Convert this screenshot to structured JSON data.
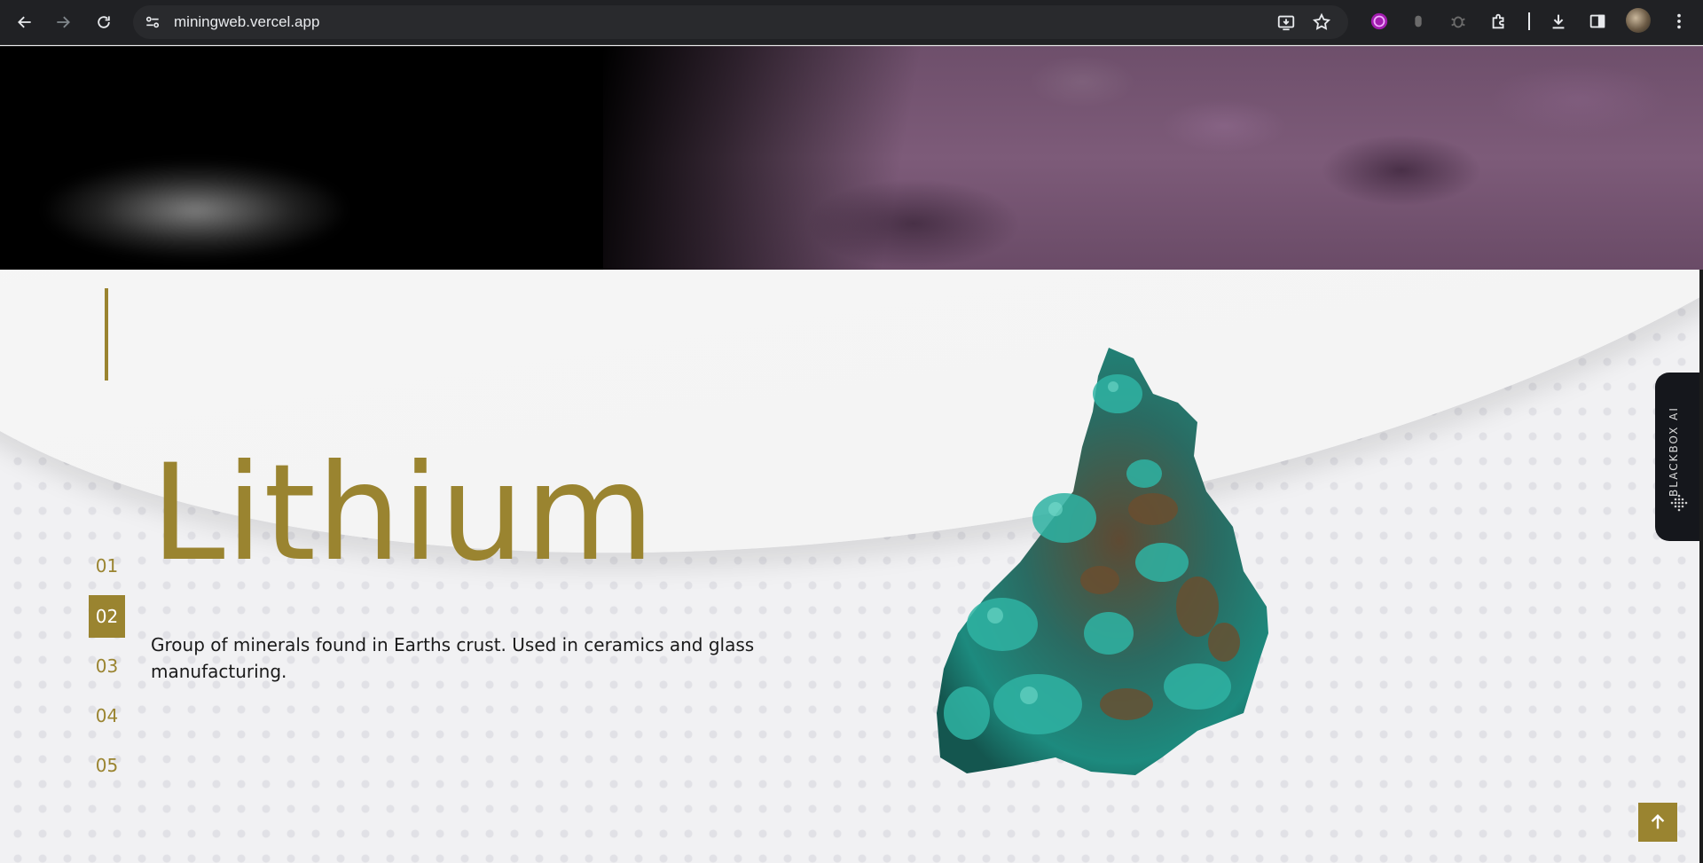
{
  "browser": {
    "url": "miningweb.vercel.app",
    "icons": [
      "back-arrow-icon",
      "forward-arrow-icon",
      "reload-icon",
      "site-info-icon",
      "install-app-icon",
      "bookmark-star-icon",
      "extensions-puzzle-icon",
      "download-icon",
      "side-panel-icon",
      "menu-kebab-icon"
    ]
  },
  "hero": {
    "image": "asteroid-surface"
  },
  "slides": {
    "items": [
      {
        "label": "01"
      },
      {
        "label": "02"
      },
      {
        "label": "03"
      },
      {
        "label": "04"
      },
      {
        "label": "05"
      }
    ],
    "active_label": "02"
  },
  "mineral": {
    "title": "Lithium",
    "description": "Group of minerals found in Earths crust. Used in ceramics and glass manufacturing.",
    "image": "green-mineral-rock"
  },
  "blackbox": {
    "label": "BLACKBOX AI"
  },
  "colors": {
    "accent_gold": "#9a8430",
    "chrome_bg": "#202124",
    "content_bg": "#f1f1f3"
  }
}
